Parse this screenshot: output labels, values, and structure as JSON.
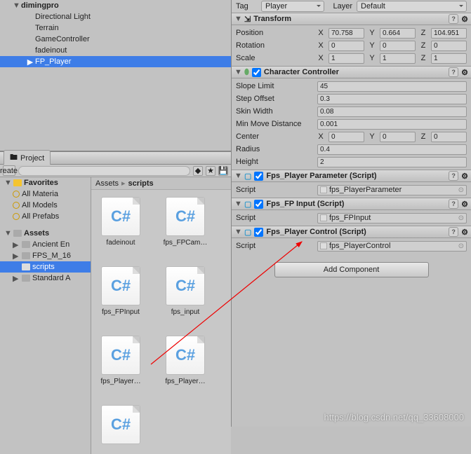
{
  "hierarchy": {
    "rootName": "dimingpro",
    "items": [
      "Directional Light",
      "Terrain",
      "GameController",
      "fadeinout",
      "FP_Player"
    ],
    "selected": "FP_Player"
  },
  "project": {
    "tabLabel": "Project",
    "createLabel": "Create",
    "favLabel": "Favorites",
    "favItems": [
      "All Materia",
      "All Models",
      "All Prefabs"
    ],
    "assetsLabel": "Assets",
    "folders": [
      "Ancient En",
      "FPS_M_16",
      "scripts",
      "Standard A"
    ],
    "selectedFolder": "scripts",
    "crumbRoot": "Assets",
    "crumbLeaf": "scripts",
    "scripts": [
      "fadeinout",
      "fps_FPCam…",
      "fps_FPInput",
      "fps_input",
      "fps_Player…",
      "fps_Player…",
      ""
    ]
  },
  "inspector": {
    "tagLabel": "Tag",
    "tagValue": "Player",
    "layerLabel": "Layer",
    "layerValue": "Default",
    "transform": {
      "title": "Transform",
      "rows": [
        {
          "label": "Position",
          "x": "70.758",
          "y": "0.664",
          "z": "104.951"
        },
        {
          "label": "Rotation",
          "x": "0",
          "y": "0",
          "z": "0"
        },
        {
          "label": "Scale",
          "x": "1",
          "y": "1",
          "z": "1"
        }
      ]
    },
    "charCtrl": {
      "title": "Character Controller",
      "slopeLabel": "Slope Limit",
      "slope": "45",
      "stepLabel": "Step Offset",
      "step": "0.3",
      "skinLabel": "Skin Width",
      "skin": "0.08",
      "minMoveLabel": "Min Move Distance",
      "minMove": "0.001",
      "centerLabel": "Center",
      "cx": "0",
      "cy": "0",
      "cz": "0",
      "radiusLabel": "Radius",
      "radius": "0.4",
      "heightLabel": "Height",
      "height": "2"
    },
    "scriptComps": [
      {
        "title": "Fps_Player Parameter (Script)",
        "scriptLabel": "Script",
        "scriptVal": "fps_PlayerParameter"
      },
      {
        "title": "Fps_FP Input (Script)",
        "scriptLabel": "Script",
        "scriptVal": "fps_FPInput"
      },
      {
        "title": "Fps_Player Control (Script)",
        "scriptLabel": "Script",
        "scriptVal": "fps_PlayerControl"
      }
    ],
    "addComponent": "Add Component"
  },
  "watermark": "https://blog.csdn.net/qq_33608000"
}
